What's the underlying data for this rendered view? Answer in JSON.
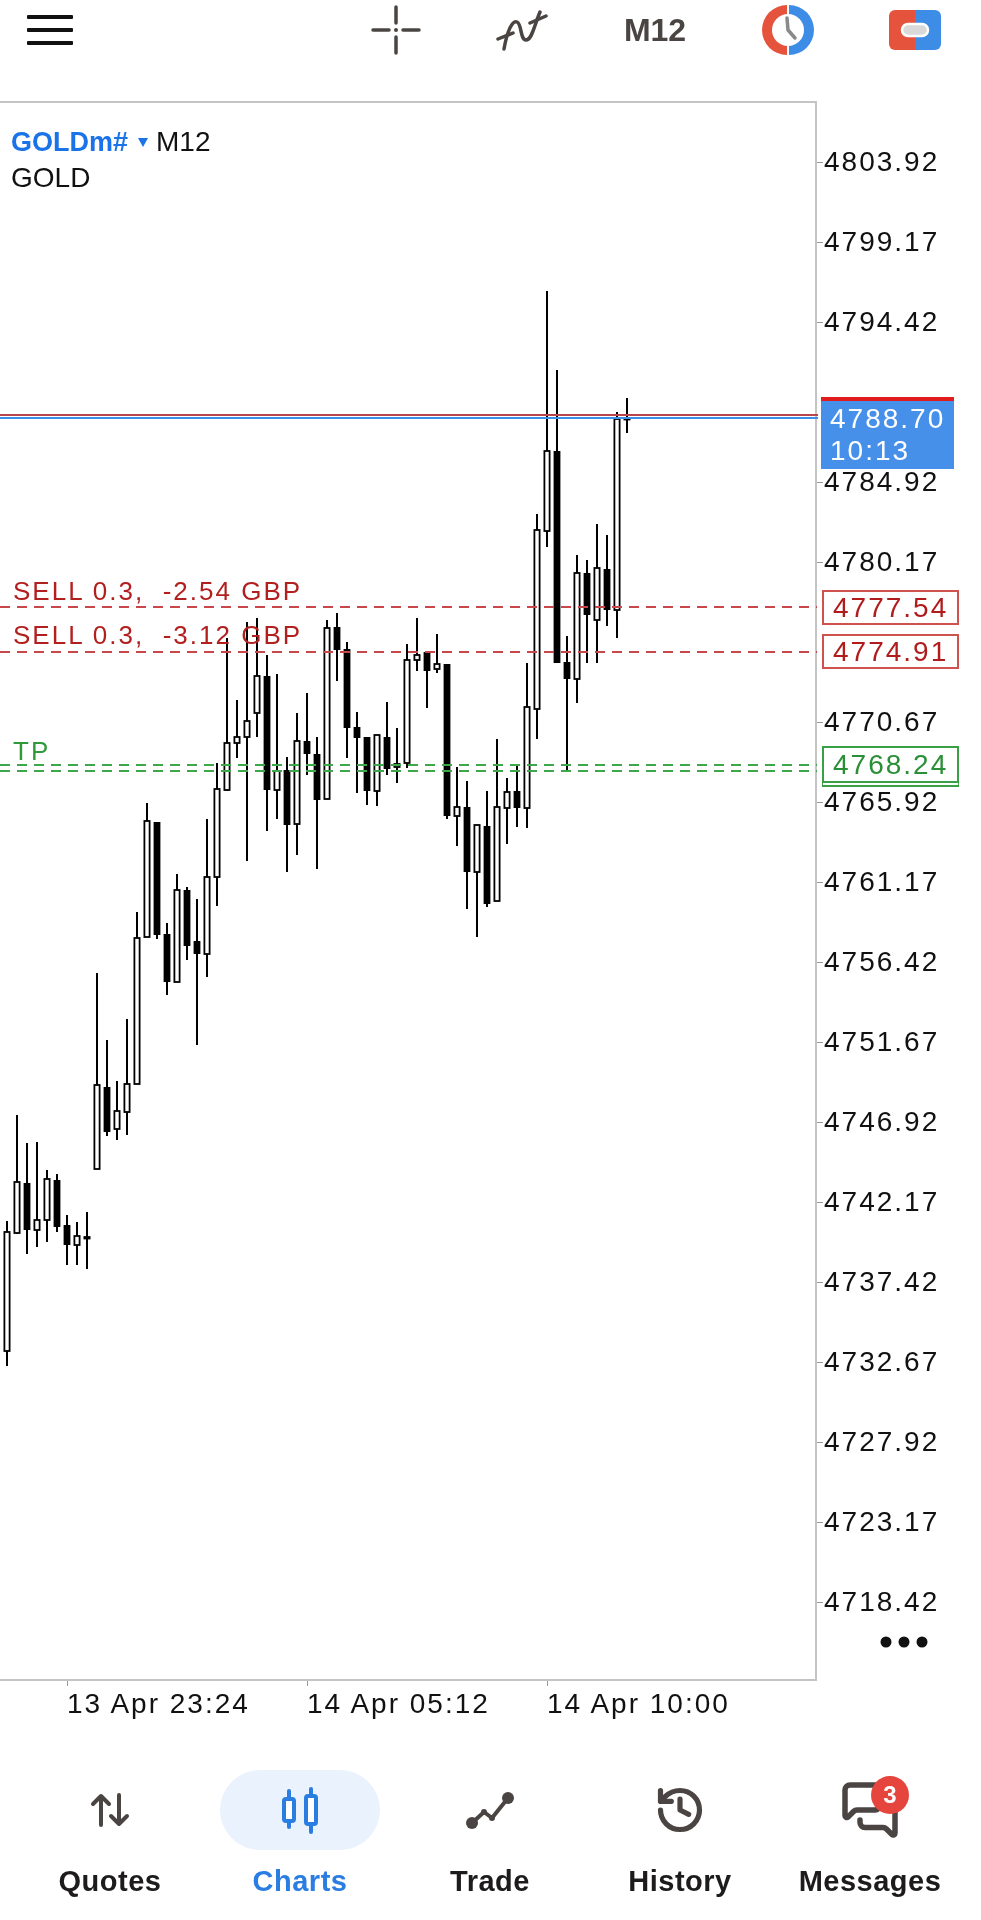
{
  "top_bar": {
    "timeframe": "M12"
  },
  "chart": {
    "symbol": "GOLDm#",
    "timeframe": "M12",
    "description": "GOLD",
    "levels": [
      {
        "kind": "bid",
        "price": "4788.70",
        "time": "10:13"
      },
      {
        "kind": "sell",
        "label": "SELL 0.3,  -2.54 GBP",
        "price": "4777.54"
      },
      {
        "kind": "sell",
        "label": "SELL 0.3,  -3.12 GBP",
        "price": "4774.91"
      },
      {
        "kind": "tp",
        "label": "TP",
        "price": "4768.24"
      }
    ],
    "price_axis": [
      "4803.92",
      "4799.17",
      "4794.42",
      "4784.92",
      "4780.17",
      "4770.67",
      "4765.92",
      "4761.17",
      "4756.42",
      "4751.67",
      "4746.92",
      "4742.17",
      "4737.42",
      "4732.67",
      "4727.92",
      "4723.17",
      "4718.42"
    ],
    "time_axis": [
      "13 Apr 23:24",
      "14 Apr 05:12",
      "14 Apr 10:00"
    ]
  },
  "bottom_nav": [
    {
      "label": "Quotes",
      "selected": false
    },
    {
      "label": "Charts",
      "selected": true
    },
    {
      "label": "Trade",
      "selected": false
    },
    {
      "label": "History",
      "selected": false
    },
    {
      "label": "Messages",
      "selected": false,
      "badge": "3"
    }
  ]
}
